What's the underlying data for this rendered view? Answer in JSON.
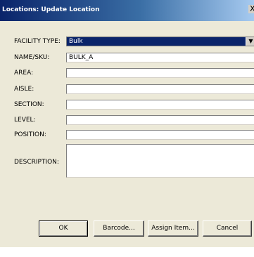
{
  "window": {
    "title": "Locations: Update Location",
    "close_glyph": "X"
  },
  "form": {
    "facility_type": {
      "label": "FACILITY TYPE:",
      "value": "Bulk",
      "arrow": "▼"
    },
    "name_sku": {
      "label": "NAME/SKU:",
      "value": "BULK_A"
    },
    "area": {
      "label": "AREA:",
      "value": ""
    },
    "aisle": {
      "label": "AISLE:",
      "value": ""
    },
    "section": {
      "label": "SECTION:",
      "value": ""
    },
    "level": {
      "label": "LEVEL:",
      "value": ""
    },
    "position": {
      "label": "POSITION:",
      "value": ""
    },
    "description": {
      "label": "DESCRIPTION:",
      "value": ""
    }
  },
  "buttons": {
    "ok": "OK",
    "barcode": "Barcode...",
    "assign_item": "Assign Item...",
    "cancel": "Cancel"
  },
  "colors": {
    "title_bar": "#0a246a",
    "dialog_bg": "#ece9d8",
    "selection": "#0a246a"
  }
}
